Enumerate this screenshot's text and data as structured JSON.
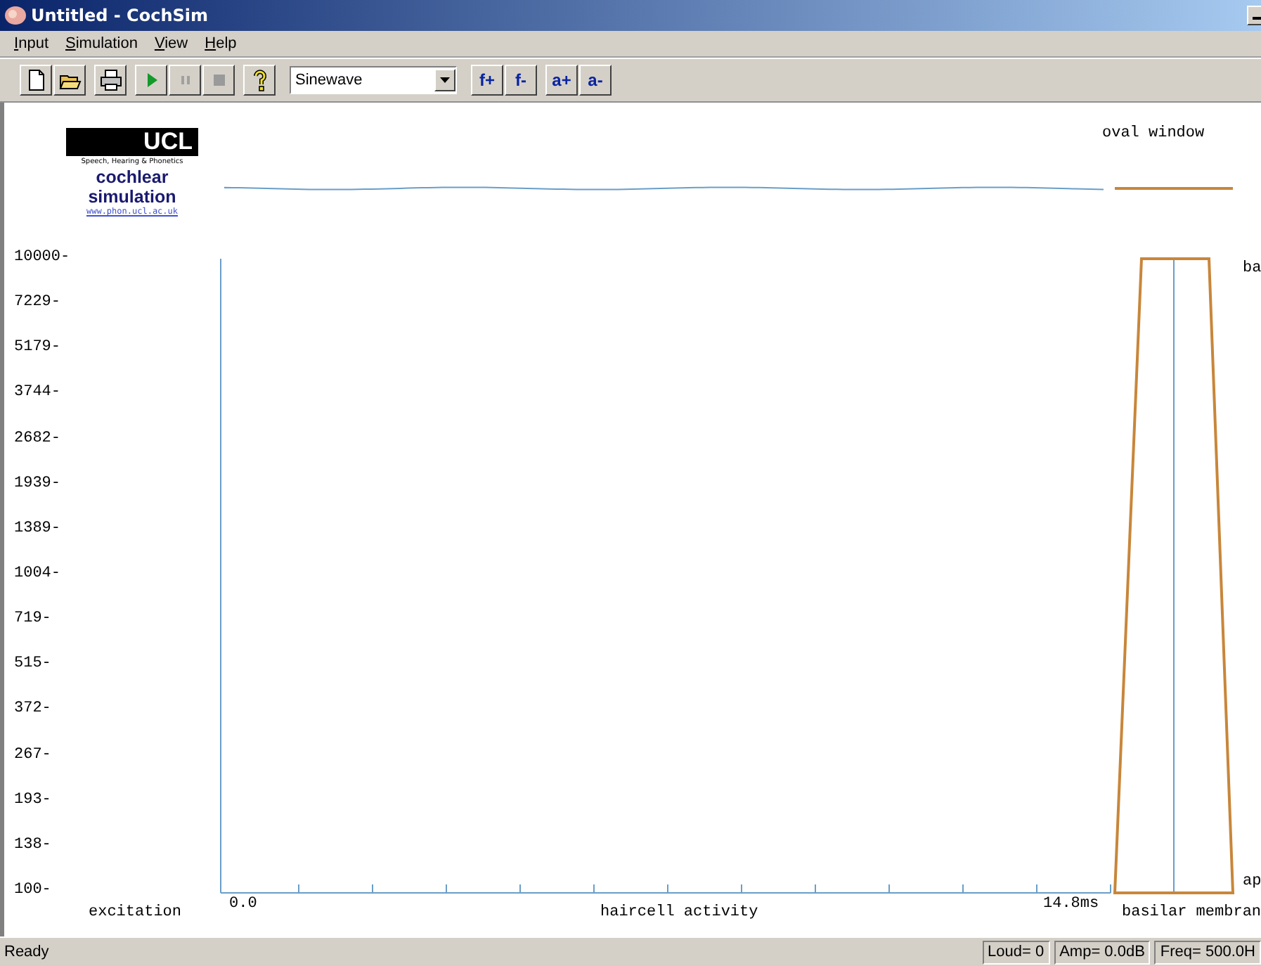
{
  "window": {
    "title": "Untitled - CochSim"
  },
  "menu": [
    {
      "label": "Input"
    },
    {
      "label": "Simulation"
    },
    {
      "label": "View"
    },
    {
      "label": "Help"
    }
  ],
  "toolbar": {
    "groups": [
      [
        {
          "kind": "new"
        },
        {
          "kind": "open"
        }
      ],
      [
        {
          "kind": "print"
        }
      ],
      [
        {
          "kind": "play",
          "disabled": false
        },
        {
          "kind": "pause",
          "disabled": true
        },
        {
          "kind": "stop",
          "disabled": true
        }
      ],
      [
        {
          "kind": "help"
        }
      ]
    ],
    "waveform": {
      "value": "Sinewave"
    },
    "text_buttons": [
      [
        "f+",
        "f-"
      ],
      [
        "a+",
        "a-"
      ]
    ]
  },
  "logo": {
    "mark": "UCL",
    "subtitle": "Speech, Hearing & Phonetics",
    "title_lines": [
      "cochlear",
      "simulation"
    ],
    "link": "www.phon.ucl.ac.uk"
  },
  "plot": {
    "frequency_labels": [
      "10000-",
      "7229-",
      "5179-",
      "3744-",
      "2682-",
      "1939-",
      "1389-",
      "1004-",
      "719-",
      "515-",
      "372-",
      "267-",
      "193-",
      "138-",
      "100-"
    ],
    "excitation_label": "excitation",
    "time_start": "0.0",
    "time_end": "14.8ms",
    "haircell_label": "haircell activity",
    "oval_window_label": "oval window",
    "base_label": "ba",
    "apex_label": "ap",
    "basilar_label": "basilar membran"
  },
  "status_bar": {
    "text": "Ready",
    "panes": [
      "Loud= 0",
      "Amp= 0.0dB",
      "Freq= 500.0H"
    ]
  }
}
